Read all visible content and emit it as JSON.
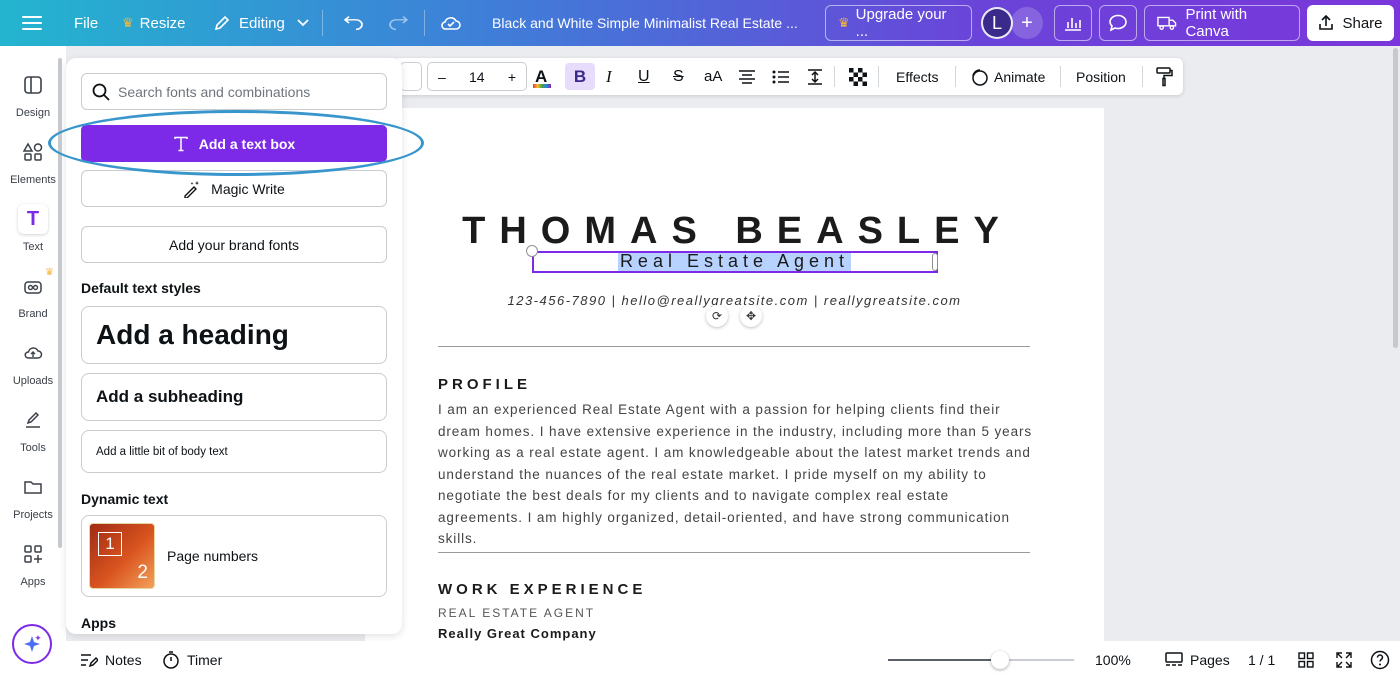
{
  "topbar": {
    "file_label": "File",
    "resize_label": "Resize",
    "editing_label": "Editing",
    "doc_title": "Black and White Simple Minimalist Real Estate ...",
    "upgrade_label": "Upgrade your ...",
    "avatar_initial": "L",
    "print_label": "Print with Canva",
    "share_label": "Share"
  },
  "rail": {
    "items": [
      {
        "label": "Design"
      },
      {
        "label": "Elements"
      },
      {
        "label": "Text"
      },
      {
        "label": "Brand"
      },
      {
        "label": "Uploads"
      },
      {
        "label": "Tools"
      },
      {
        "label": "Projects"
      },
      {
        "label": "Apps"
      }
    ]
  },
  "panel": {
    "search_placeholder": "Search fonts and combinations",
    "add_text_box": "Add a text box",
    "magic_write": "Magic Write",
    "brand_fonts": "Add your brand fonts",
    "default_styles_title": "Default text styles",
    "heading": "Add a heading",
    "subheading": "Add a subheading",
    "body": "Add a little bit of body text",
    "dynamic_title": "Dynamic text",
    "page_numbers": "Page numbers",
    "thumb_num_1": "1",
    "thumb_num_2": "2",
    "apps_title": "Apps"
  },
  "toolbar": {
    "font_size": "14",
    "minus": "–",
    "plus": "+",
    "bold": "B",
    "case_label": "aA",
    "effects_label": "Effects",
    "animate_label": "Animate",
    "position_label": "Position"
  },
  "resume": {
    "name": "THOMAS BEASLEY",
    "role": "Real Estate Agent",
    "contact": "123-456-7890  |  hello@reallygreatsite.com  |  reallygreatsite.com",
    "profile_title": "PROFILE",
    "profile_body": "I am an experienced Real Estate Agent with a passion for helping clients find their dream homes. I have extensive experience in the industry, including more than 5 years working as a real estate agent. I am knowledgeable about the latest market trends and understand the nuances of the real estate market. I pride myself on my ability to negotiate the best deals for my clients and to navigate complex real estate agreements. I am highly organized, detail-oriented, and have strong communication skills.",
    "work_title": "WORK EXPERIENCE",
    "job_title": "REAL ESTATE AGENT",
    "company": "Really Great Company"
  },
  "bottombar": {
    "notes_label": "Notes",
    "timer_label": "Timer",
    "zoom_value": 0.6,
    "zoom_label": "100%",
    "pages_label": "Pages",
    "page_indicator": "1 / 1"
  },
  "colors": {
    "accent_purple": "#7d2ae8",
    "highlight_ellipse": "#3896cc",
    "selection_highlight": "#b7d2ff"
  }
}
